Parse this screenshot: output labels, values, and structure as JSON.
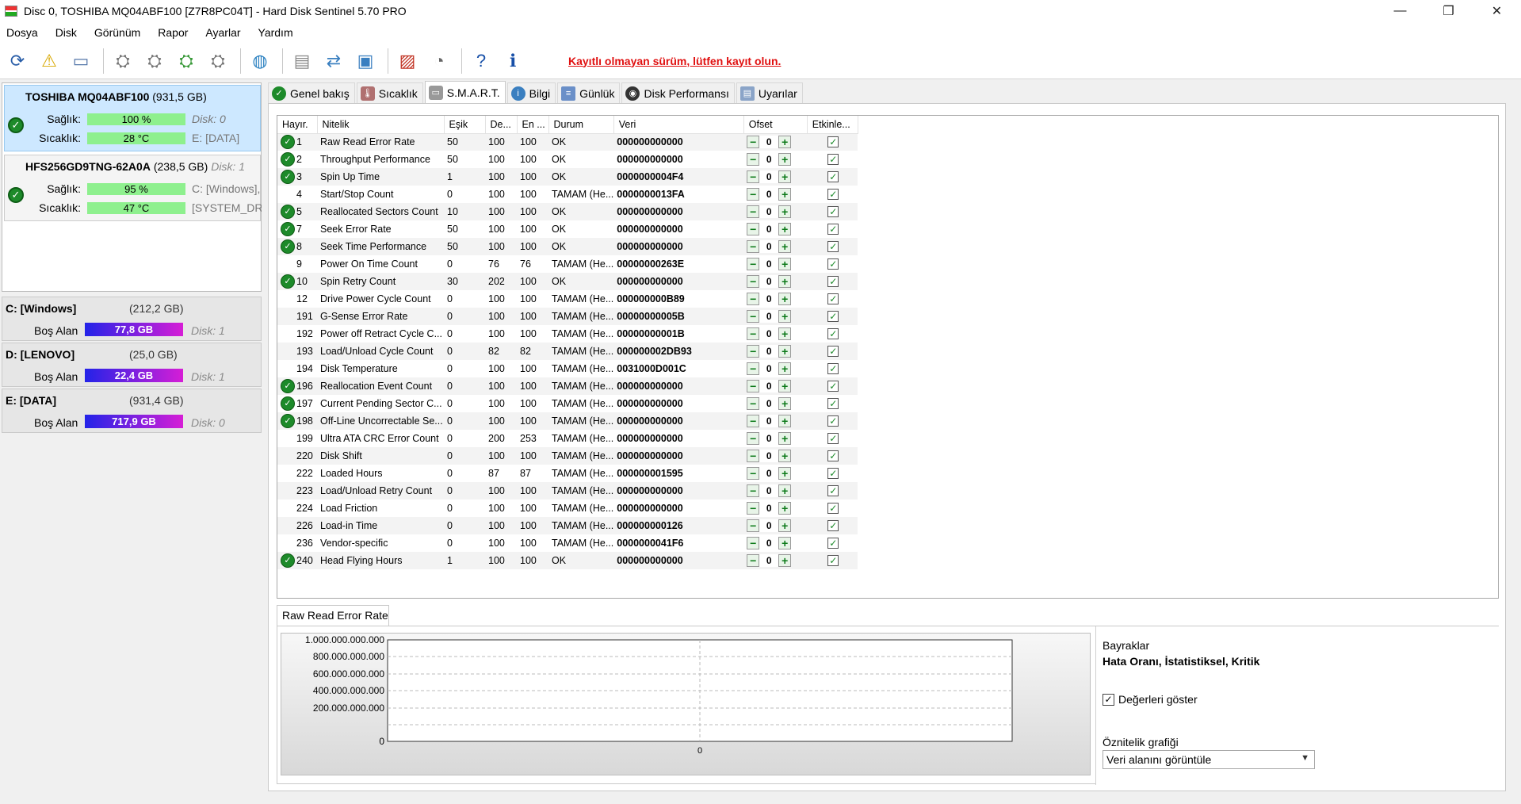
{
  "window": {
    "title": "Disc 0, TOSHIBA MQ04ABF100 [Z7R8PC04T]  -  Hard Disk Sentinel 5.70 PRO",
    "minimize": "—",
    "restore": "❐",
    "close": "✕"
  },
  "menu": [
    "Dosya",
    "Disk",
    "Görünüm",
    "Rapor",
    "Ayarlar",
    "Yardım"
  ],
  "toolbar": {
    "warning": "Kayıtlı olmayan sürüm, lütfen kayıt olun."
  },
  "disks": [
    {
      "name": "TOSHIBA MQ04ABF100",
      "size": "(931,5 GB)",
      "health_label": "Sağlık:",
      "health": "100 %",
      "health_pct": 100,
      "temp_label": "Sıcaklık:",
      "temp": "28 °C",
      "disk_no": "Disk: 0",
      "vol": "E: [DATA]"
    },
    {
      "name": "HFS256GD9TNG-62A0A",
      "size": "(238,5 GB)",
      "disk_no": "Disk: 1",
      "health_label": "Sağlık:",
      "health": "95 %",
      "health_pct": 95,
      "temp_label": "Sıcaklık:",
      "temp": "47 °C",
      "vol": "C: [Windows],",
      "vol2": "[SYSTEM_DRV]"
    }
  ],
  "volumes": [
    {
      "name": "C: [Windows]",
      "size": "(212,2 GB)",
      "free_label": "Boş Alan",
      "free": "77,8 GB",
      "disk": "Disk: 1"
    },
    {
      "name": "D: [LENOVO]",
      "size": "(25,0 GB)",
      "free_label": "Boş Alan",
      "free": "22,4 GB",
      "disk": "Disk: 1"
    },
    {
      "name": "E: [DATA]",
      "size": "(931,4 GB)",
      "free_label": "Boş Alan",
      "free": "717,9 GB",
      "disk": "Disk: 0"
    }
  ],
  "tabs": [
    "Genel bakış",
    "Sıcaklık",
    "S.M.A.R.T.",
    "Bilgi",
    "Günlük",
    "Disk Performansı",
    "Uyarılar"
  ],
  "smart": {
    "headers": [
      "Hayır.",
      "Nitelik",
      "Eşik",
      "De...",
      "En ...",
      "Durum",
      "Veri",
      "Ofset",
      "Etkinle..."
    ],
    "rows": [
      {
        "ok": true,
        "no": "1",
        "name": "Raw Read Error Rate",
        "esik": "50",
        "de": "100",
        "en": "100",
        "durum": "OK",
        "veri": "000000000000",
        "ofset": "0"
      },
      {
        "ok": true,
        "no": "2",
        "name": "Throughput Performance",
        "esik": "50",
        "de": "100",
        "en": "100",
        "durum": "OK",
        "veri": "000000000000",
        "ofset": "0"
      },
      {
        "ok": true,
        "no": "3",
        "name": "Spin Up Time",
        "esik": "1",
        "de": "100",
        "en": "100",
        "durum": "OK",
        "veri": "0000000004F4",
        "ofset": "0"
      },
      {
        "ok": false,
        "no": "4",
        "name": "Start/Stop Count",
        "esik": "0",
        "de": "100",
        "en": "100",
        "durum": "TAMAM (He...",
        "veri": "0000000013FA",
        "ofset": "0"
      },
      {
        "ok": true,
        "no": "5",
        "name": "Reallocated Sectors Count",
        "esik": "10",
        "de": "100",
        "en": "100",
        "durum": "OK",
        "veri": "000000000000",
        "ofset": "0"
      },
      {
        "ok": true,
        "no": "7",
        "name": "Seek Error Rate",
        "esik": "50",
        "de": "100",
        "en": "100",
        "durum": "OK",
        "veri": "000000000000",
        "ofset": "0"
      },
      {
        "ok": true,
        "no": "8",
        "name": "Seek Time Performance",
        "esik": "50",
        "de": "100",
        "en": "100",
        "durum": "OK",
        "veri": "000000000000",
        "ofset": "0"
      },
      {
        "ok": false,
        "no": "9",
        "name": "Power On Time Count",
        "esik": "0",
        "de": "76",
        "en": "76",
        "durum": "TAMAM (He...",
        "veri": "00000000263E",
        "ofset": "0"
      },
      {
        "ok": true,
        "no": "10",
        "name": "Spin Retry Count",
        "esik": "30",
        "de": "202",
        "en": "100",
        "durum": "OK",
        "veri": "000000000000",
        "ofset": "0"
      },
      {
        "ok": false,
        "no": "12",
        "name": "Drive Power Cycle Count",
        "esik": "0",
        "de": "100",
        "en": "100",
        "durum": "TAMAM (He...",
        "veri": "000000000B89",
        "ofset": "0"
      },
      {
        "ok": false,
        "no": "191",
        "name": "G-Sense Error Rate",
        "esik": "0",
        "de": "100",
        "en": "100",
        "durum": "TAMAM (He...",
        "veri": "00000000005B",
        "ofset": "0"
      },
      {
        "ok": false,
        "no": "192",
        "name": "Power off Retract Cycle C...",
        "esik": "0",
        "de": "100",
        "en": "100",
        "durum": "TAMAM (He...",
        "veri": "00000000001B",
        "ofset": "0"
      },
      {
        "ok": false,
        "no": "193",
        "name": "Load/Unload Cycle Count",
        "esik": "0",
        "de": "82",
        "en": "82",
        "durum": "TAMAM (He...",
        "veri": "000000002DB93",
        "ofset": "0"
      },
      {
        "ok": false,
        "no": "194",
        "name": "Disk Temperature",
        "esik": "0",
        "de": "100",
        "en": "100",
        "durum": "TAMAM (He...",
        "veri": "0031000D001C",
        "ofset": "0"
      },
      {
        "ok": true,
        "no": "196",
        "name": "Reallocation Event Count",
        "esik": "0",
        "de": "100",
        "en": "100",
        "durum": "TAMAM (He...",
        "veri": "000000000000",
        "ofset": "0"
      },
      {
        "ok": true,
        "no": "197",
        "name": "Current Pending Sector C...",
        "esik": "0",
        "de": "100",
        "en": "100",
        "durum": "TAMAM (He...",
        "veri": "000000000000",
        "ofset": "0"
      },
      {
        "ok": true,
        "no": "198",
        "name": "Off-Line Uncorrectable Se...",
        "esik": "0",
        "de": "100",
        "en": "100",
        "durum": "TAMAM (He...",
        "veri": "000000000000",
        "ofset": "0"
      },
      {
        "ok": false,
        "no": "199",
        "name": "Ultra ATA CRC Error Count",
        "esik": "0",
        "de": "200",
        "en": "253",
        "durum": "TAMAM (He...",
        "veri": "000000000000",
        "ofset": "0"
      },
      {
        "ok": false,
        "no": "220",
        "name": "Disk Shift",
        "esik": "0",
        "de": "100",
        "en": "100",
        "durum": "TAMAM (He...",
        "veri": "000000000000",
        "ofset": "0"
      },
      {
        "ok": false,
        "no": "222",
        "name": "Loaded Hours",
        "esik": "0",
        "de": "87",
        "en": "87",
        "durum": "TAMAM (He...",
        "veri": "000000001595",
        "ofset": "0"
      },
      {
        "ok": false,
        "no": "223",
        "name": "Load/Unload Retry Count",
        "esik": "0",
        "de": "100",
        "en": "100",
        "durum": "TAMAM (He...",
        "veri": "000000000000",
        "ofset": "0"
      },
      {
        "ok": false,
        "no": "224",
        "name": "Load Friction",
        "esik": "0",
        "de": "100",
        "en": "100",
        "durum": "TAMAM (He...",
        "veri": "000000000000",
        "ofset": "0"
      },
      {
        "ok": false,
        "no": "226",
        "name": "Load-in Time",
        "esik": "0",
        "de": "100",
        "en": "100",
        "durum": "TAMAM (He...",
        "veri": "000000000126",
        "ofset": "0"
      },
      {
        "ok": false,
        "no": "236",
        "name": "Vendor-specific",
        "esik": "0",
        "de": "100",
        "en": "100",
        "durum": "TAMAM (He...",
        "veri": "0000000041F6",
        "ofset": "0"
      },
      {
        "ok": true,
        "no": "240",
        "name": "Head Flying Hours",
        "esik": "1",
        "de": "100",
        "en": "100",
        "durum": "OK",
        "veri": "000000000000",
        "ofset": "0"
      }
    ]
  },
  "graph": {
    "tab": "Raw Read Error Rate",
    "yticks": [
      "1.000.000.000.000",
      "800.000.000.000",
      "600.000.000.000",
      "400.000.000.000",
      "200.000.000.000",
      "0"
    ],
    "xtick": "0",
    "flags_label": "Bayraklar",
    "flags_value": "Hata Oranı, İstatistiksel, Kritik",
    "show_values": "Değerleri göster",
    "attr_graph_label": "Öznitelik grafiği",
    "attr_graph_select": "Veri alanını görüntüle"
  }
}
